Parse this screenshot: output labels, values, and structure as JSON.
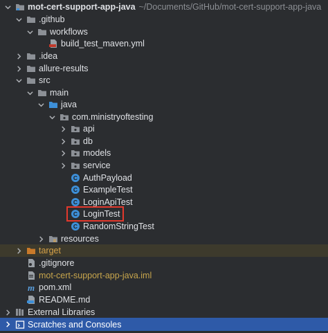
{
  "tree": {
    "root": {
      "name": "mot-cert-support-app-java",
      "path": "~/Documents/GitHub/mot-cert-support-app-java"
    },
    "items": [
      {
        "label": ".github",
        "icon": "folder-icon"
      },
      {
        "label": "workflows",
        "icon": "folder-icon"
      },
      {
        "label": "build_test_maven.yml",
        "icon": "yaml-file-icon"
      },
      {
        "label": ".idea",
        "icon": "folder-icon"
      },
      {
        "label": "allure-results",
        "icon": "folder-icon"
      },
      {
        "label": "src",
        "icon": "folder-icon"
      },
      {
        "label": "main",
        "icon": "folder-icon"
      },
      {
        "label": "java",
        "icon": "source-folder-icon"
      },
      {
        "label": "com.ministryoftesting",
        "icon": "package-icon"
      },
      {
        "label": "api",
        "icon": "package-icon"
      },
      {
        "label": "db",
        "icon": "package-icon"
      },
      {
        "label": "models",
        "icon": "package-icon"
      },
      {
        "label": "service",
        "icon": "package-icon"
      },
      {
        "label": "AuthPayload",
        "icon": "class-icon"
      },
      {
        "label": "ExampleTest",
        "icon": "class-icon"
      },
      {
        "label": "LoginApiTest",
        "icon": "class-icon"
      },
      {
        "label": "LoginTest",
        "icon": "class-icon"
      },
      {
        "label": "RandomStringTest",
        "icon": "class-icon"
      },
      {
        "label": "resources",
        "icon": "folder-icon"
      },
      {
        "label": "target",
        "icon": "excluded-folder-icon"
      },
      {
        "label": ".gitignore",
        "icon": "gitignore-icon"
      },
      {
        "label": "mot-cert-support-app-java.iml",
        "icon": "iml-file-icon"
      },
      {
        "label": "pom.xml",
        "icon": "maven-icon"
      },
      {
        "label": "README.md",
        "icon": "markdown-icon"
      },
      {
        "label": "External Libraries",
        "icon": "libraries-icon"
      },
      {
        "label": "Scratches and Consoles",
        "icon": "scratches-icon"
      }
    ]
  },
  "colors": {
    "background": "#2b2d30",
    "text": "#dfe1e5",
    "selection": "#2e5aa8",
    "folder": "#8c9096",
    "source_folder": "#3d8fd8",
    "class_icon": "#3d8fd8",
    "excluded_folder": "#c97a2a",
    "highlight": "#e3382c"
  }
}
